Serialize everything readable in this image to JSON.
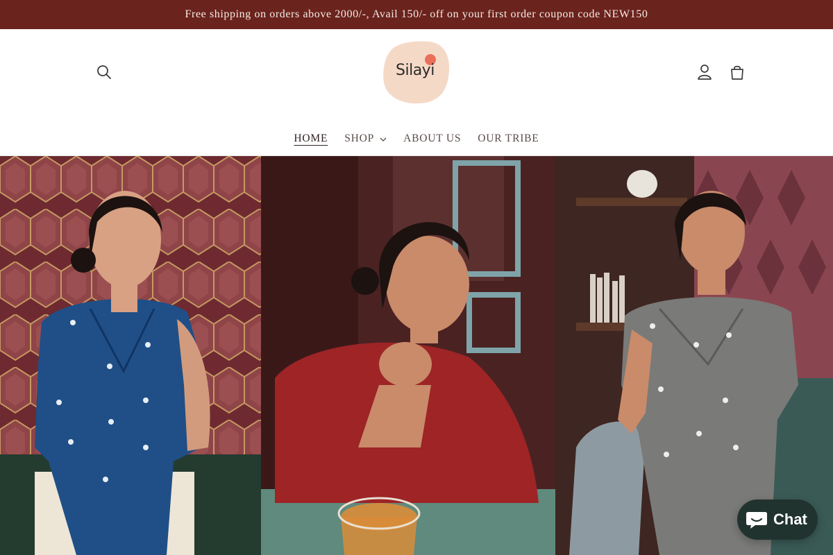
{
  "announcement": {
    "text": "Free shipping on orders above 2000/-, Avail 150/- off on your first order coupon code NEW150"
  },
  "header": {
    "logo_text": "Silayi",
    "icons": {
      "search": "search-icon",
      "account": "account-icon",
      "cart": "cart-icon"
    }
  },
  "nav": {
    "items": [
      {
        "label": "HOME",
        "active": true
      },
      {
        "label": "SHOP",
        "has_dropdown": true
      },
      {
        "label": "ABOUT US"
      },
      {
        "label": "OUR TRIBE"
      }
    ]
  },
  "hero": {
    "panels": [
      {
        "top": "blue wrap top"
      },
      {
        "top": "red top"
      },
      {
        "top": "grey wrap top"
      }
    ]
  },
  "chat": {
    "label": "Chat",
    "icon": "chat-bubble-icon"
  },
  "colors": {
    "announcement_bg": "#6b231d",
    "chat_bg": "#21332f"
  }
}
